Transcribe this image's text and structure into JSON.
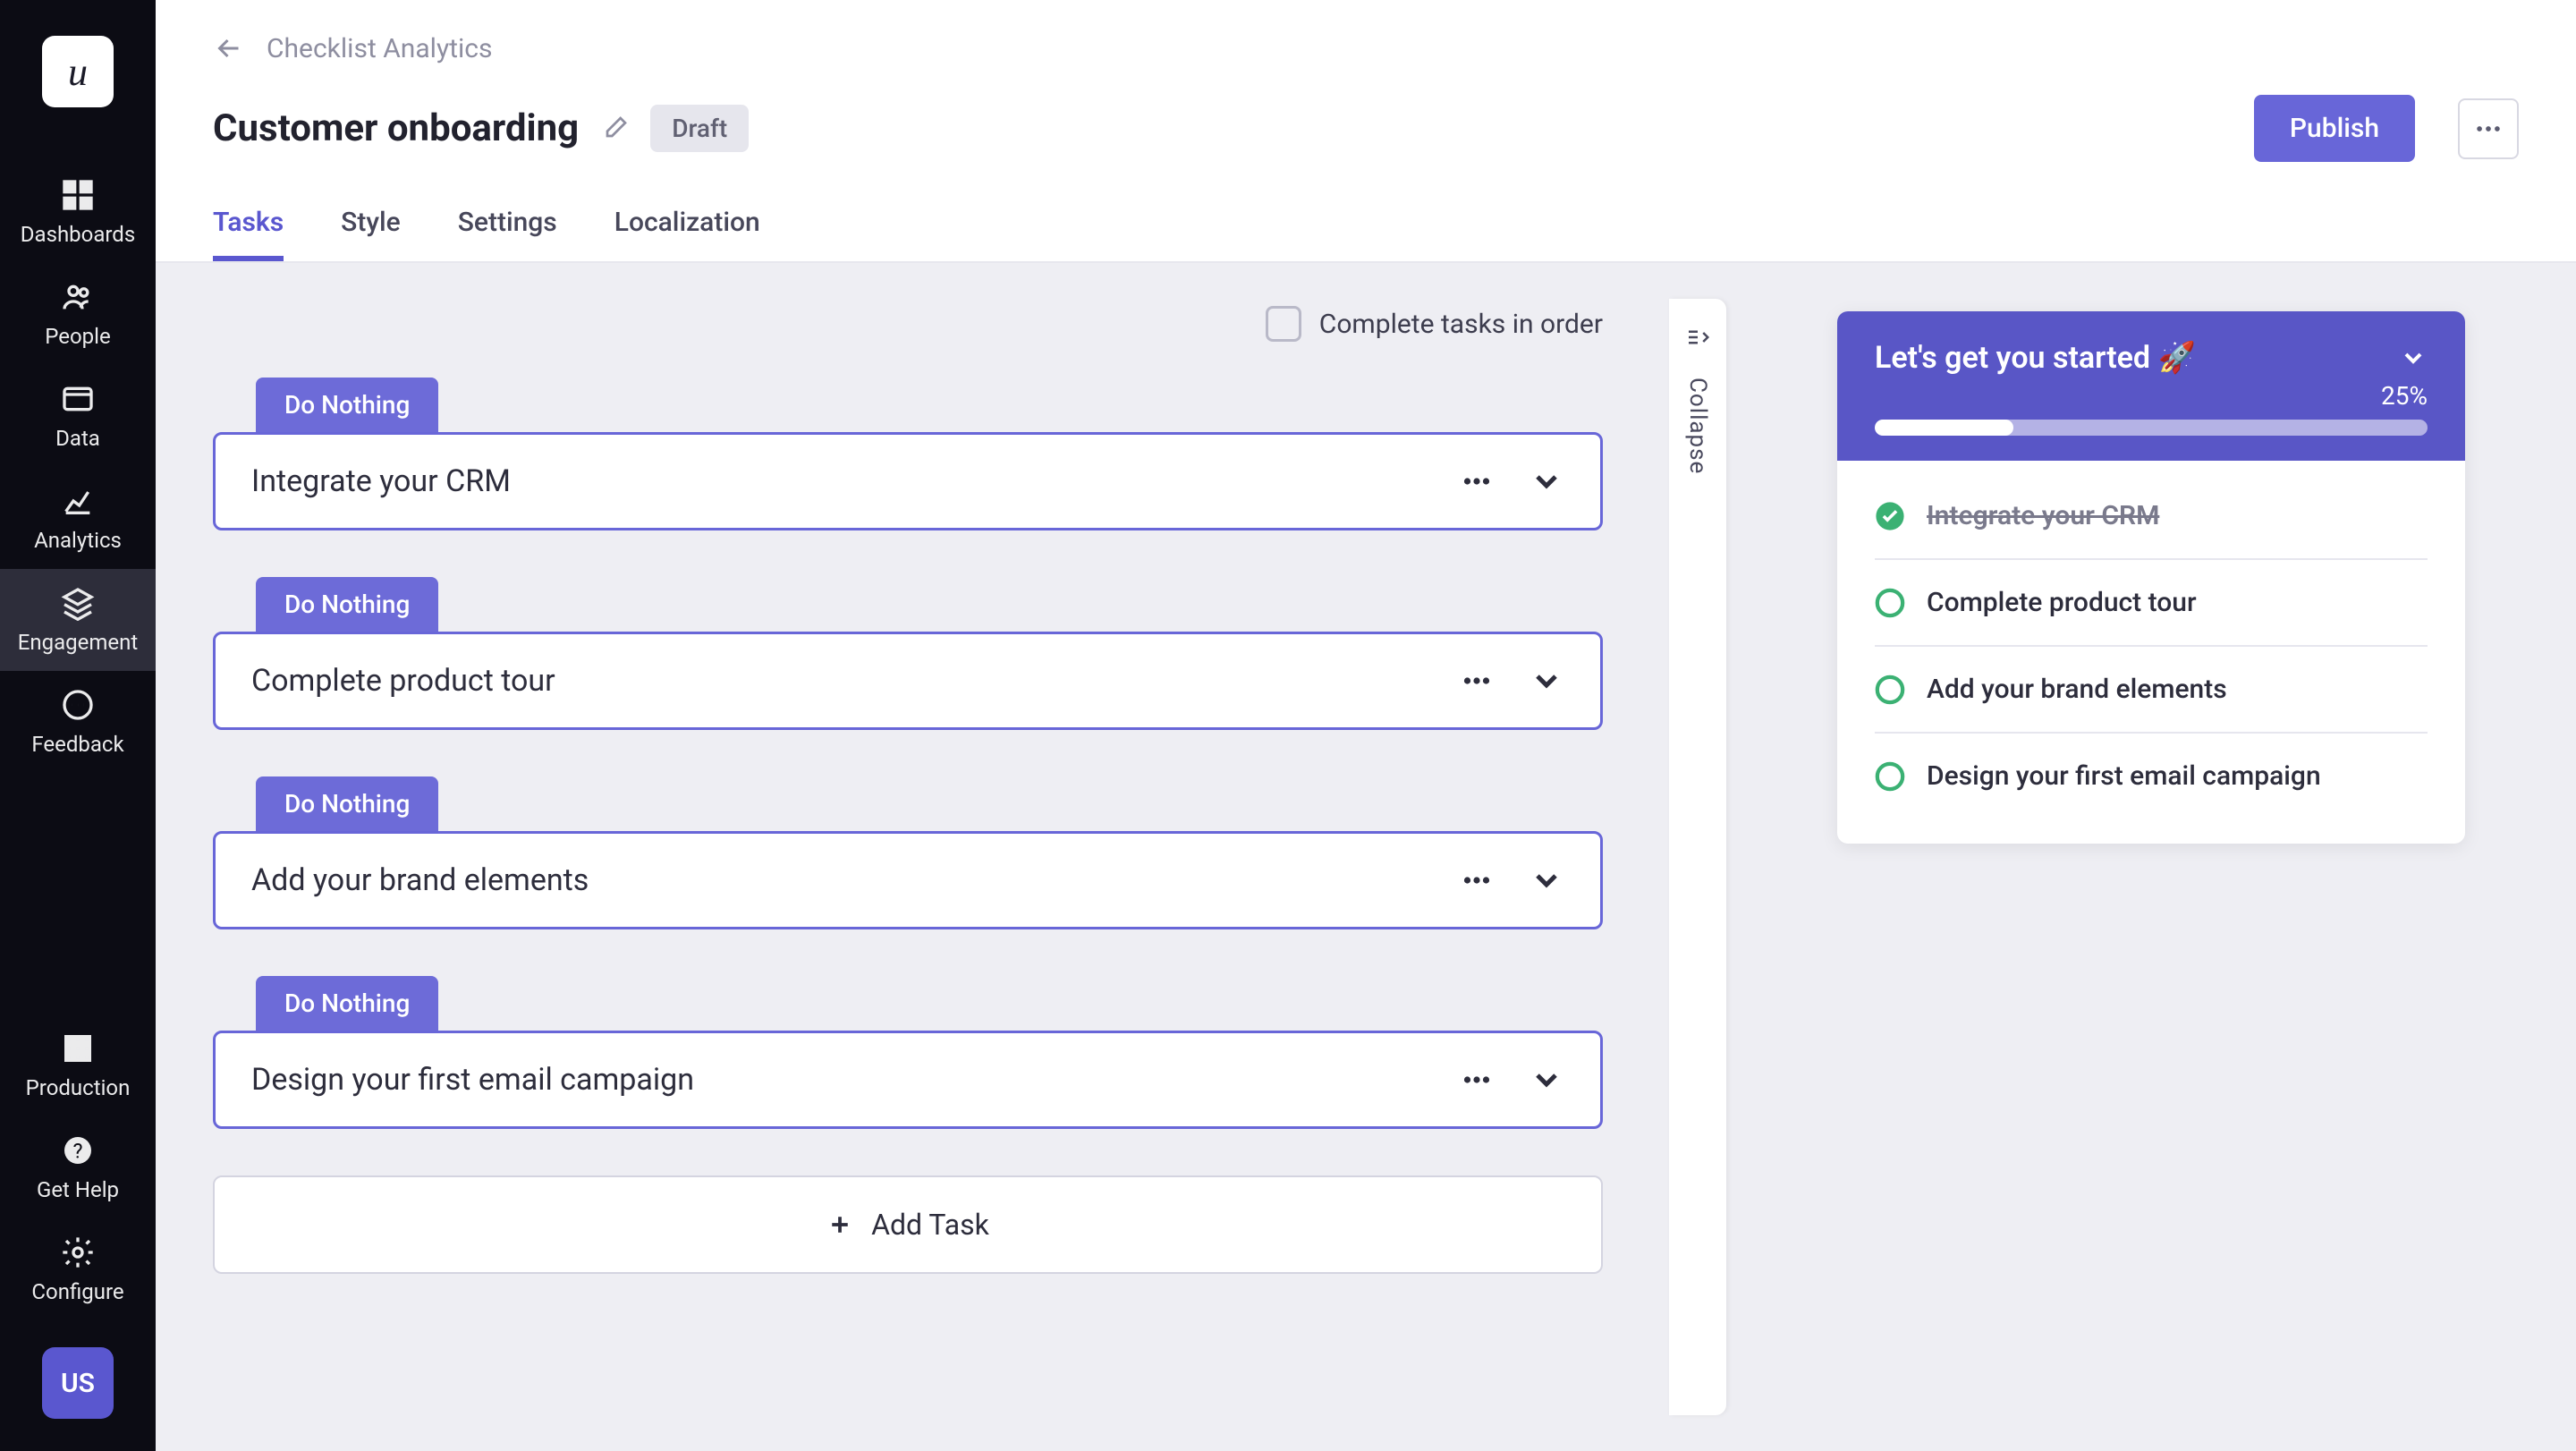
{
  "logo_text": "u",
  "sidebar": {
    "items": [
      {
        "label": "Dashboards"
      },
      {
        "label": "People"
      },
      {
        "label": "Data"
      },
      {
        "label": "Analytics"
      },
      {
        "label": "Engagement"
      },
      {
        "label": "Feedback"
      }
    ],
    "bottom": [
      {
        "label": "Production"
      },
      {
        "label": "Get Help"
      },
      {
        "label": "Configure"
      }
    ],
    "avatar": "US"
  },
  "breadcrumb": "Checklist Analytics",
  "page_title": "Customer onboarding",
  "status": "Draft",
  "publish_label": "Publish",
  "tabs": [
    {
      "label": "Tasks",
      "active": true
    },
    {
      "label": "Style"
    },
    {
      "label": "Settings"
    },
    {
      "label": "Localization"
    }
  ],
  "order_label": "Complete tasks in order",
  "task_tag": "Do Nothing",
  "tasks": [
    {
      "title": "Integrate your CRM"
    },
    {
      "title": "Complete product tour"
    },
    {
      "title": "Add your brand elements"
    },
    {
      "title": "Design your first email campaign"
    }
  ],
  "add_task_label": "Add Task",
  "collapse_label": "Collapse",
  "preview": {
    "title": "Let's get you started 🚀",
    "percent": "25%",
    "progress": 25,
    "items": [
      {
        "label": "Integrate your CRM",
        "done": true
      },
      {
        "label": "Complete product tour",
        "done": false
      },
      {
        "label": "Add your brand elements",
        "done": false
      },
      {
        "label": "Design your first email campaign",
        "done": false
      }
    ]
  }
}
